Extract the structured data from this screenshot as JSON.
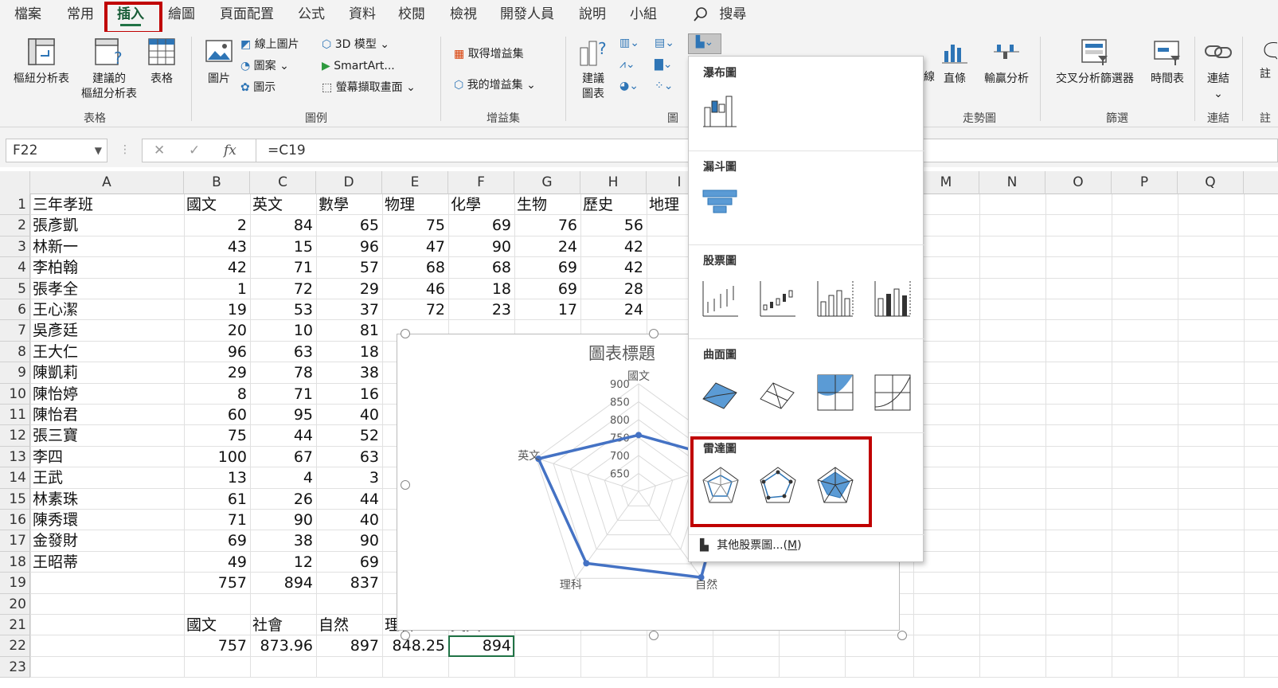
{
  "menu": {
    "tabs": [
      "檔案",
      "常用",
      "插入",
      "繪圖",
      "頁面配置",
      "公式",
      "資料",
      "校閱",
      "檢視",
      "開發人員",
      "說明",
      "小組"
    ],
    "active_tab": "插入",
    "search": "搜尋"
  },
  "ribbon": {
    "tables": {
      "pivot": "樞紐分析表",
      "rec_pivot_1": "建議的",
      "rec_pivot_2": "樞紐分析表",
      "table": "表格",
      "group": "表格"
    },
    "illustrations": {
      "picture": "圖片",
      "online_picture": "線上圖片",
      "shapes": "圖案",
      "icons": "圖示",
      "model3d": "3D 模型",
      "smartart": "SmartArt...",
      "screenshot": "螢幕擷取畫面",
      "group": "圖例"
    },
    "addins": {
      "get": "取得增益集",
      "mine": "我的增益集",
      "group": "增益集"
    },
    "charts": {
      "rec_1": "建議",
      "rec_2": "圖表",
      "group": "圖"
    },
    "sparklines": {
      "line_partial": "線",
      "column": "直條",
      "winloss": "輸贏分析",
      "group": "走勢圖"
    },
    "filters": {
      "slicer": "交叉分析篩選器",
      "timeline": "時間表",
      "group": "篩選"
    },
    "links": {
      "link": "連結",
      "group": "連結"
    },
    "comments": {
      "comment_partial": "註",
      "group_partial": "註"
    }
  },
  "formula_bar": {
    "name_box": "F22",
    "x": "✕",
    "check": "✓",
    "fx": "fx",
    "formula": "=C19"
  },
  "columns": [
    "A",
    "B",
    "C",
    "D",
    "E",
    "F",
    "G",
    "H",
    "I",
    "M",
    "N",
    "O",
    "P",
    "Q"
  ],
  "rows": [
    "1",
    "2",
    "3",
    "4",
    "5",
    "6",
    "7",
    "8",
    "9",
    "10",
    "11",
    "12",
    "13",
    "14",
    "15",
    "16",
    "17",
    "18",
    "19",
    "20",
    "21",
    "22",
    "23"
  ],
  "sheet": {
    "header": [
      "三年孝班",
      "國文",
      "英文",
      "數學",
      "物理",
      "化學",
      "生物",
      "歷史",
      "地理"
    ],
    "students": [
      {
        "name": "張彥凱",
        "scores": [
          "2",
          "84",
          "65",
          "75",
          "69",
          "76",
          "56"
        ]
      },
      {
        "name": "林新一",
        "scores": [
          "43",
          "15",
          "96",
          "47",
          "90",
          "24",
          "42"
        ]
      },
      {
        "name": "李柏翰",
        "scores": [
          "42",
          "71",
          "57",
          "68",
          "68",
          "69",
          "42"
        ]
      },
      {
        "name": "張孝全",
        "scores": [
          "1",
          "72",
          "29",
          "46",
          "18",
          "69",
          "28"
        ]
      },
      {
        "name": "王心潔",
        "scores": [
          "19",
          "53",
          "37",
          "72",
          "23",
          "17",
          "24"
        ]
      },
      {
        "name": "吳彥廷",
        "scores": [
          "20",
          "10",
          "81"
        ]
      },
      {
        "name": "王大仁",
        "scores": [
          "96",
          "63",
          "18"
        ]
      },
      {
        "name": "陳凱莉",
        "scores": [
          "29",
          "78",
          "38"
        ]
      },
      {
        "name": "陳怡婷",
        "scores": [
          "8",
          "71",
          "16"
        ]
      },
      {
        "name": "陳怡君",
        "scores": [
          "60",
          "95",
          "40"
        ]
      },
      {
        "name": "張三寶",
        "scores": [
          "75",
          "44",
          "52"
        ]
      },
      {
        "name": "李四",
        "scores": [
          "100",
          "67",
          "63"
        ]
      },
      {
        "name": "王武",
        "scores": [
          "13",
          "4",
          "3"
        ]
      },
      {
        "name": "林素珠",
        "scores": [
          "61",
          "26",
          "44"
        ]
      },
      {
        "name": "陳秀環",
        "scores": [
          "71",
          "90",
          "40"
        ]
      },
      {
        "name": "金發財",
        "scores": [
          "69",
          "38",
          "90"
        ]
      },
      {
        "name": "王昭蒂",
        "scores": [
          "49",
          "12",
          "69"
        ]
      }
    ],
    "row19": [
      "757",
      "894",
      "837"
    ],
    "row21": [
      "國文",
      "社會",
      "自然",
      "理科",
      "英文"
    ],
    "row22": [
      "757",
      "873.96",
      "897",
      "848.25",
      "894"
    ]
  },
  "chart_data": {
    "type": "radar",
    "title": "圖表標題",
    "categories": [
      "國文",
      "社會",
      "自然",
      "理科",
      "英文"
    ],
    "values": [
      757,
      873.96,
      897,
      848.25,
      894
    ],
    "r_ticks": [
      "900",
      "850",
      "800",
      "750",
      "700",
      "650"
    ],
    "r_range": [
      600,
      900
    ],
    "color": "#4472c4",
    "grid": true
  },
  "dropdown": {
    "sections": [
      "瀑布圖",
      "漏斗圖",
      "股票圖",
      "曲面圖",
      "雷達圖"
    ],
    "more_label": "其他股票圖...(",
    "more_key": "M",
    "more_close": ")"
  },
  "colors": {
    "accent": "#217346",
    "highlight": "#c00000",
    "series": "#4472c4",
    "icon_blue": "#2e75b6"
  }
}
